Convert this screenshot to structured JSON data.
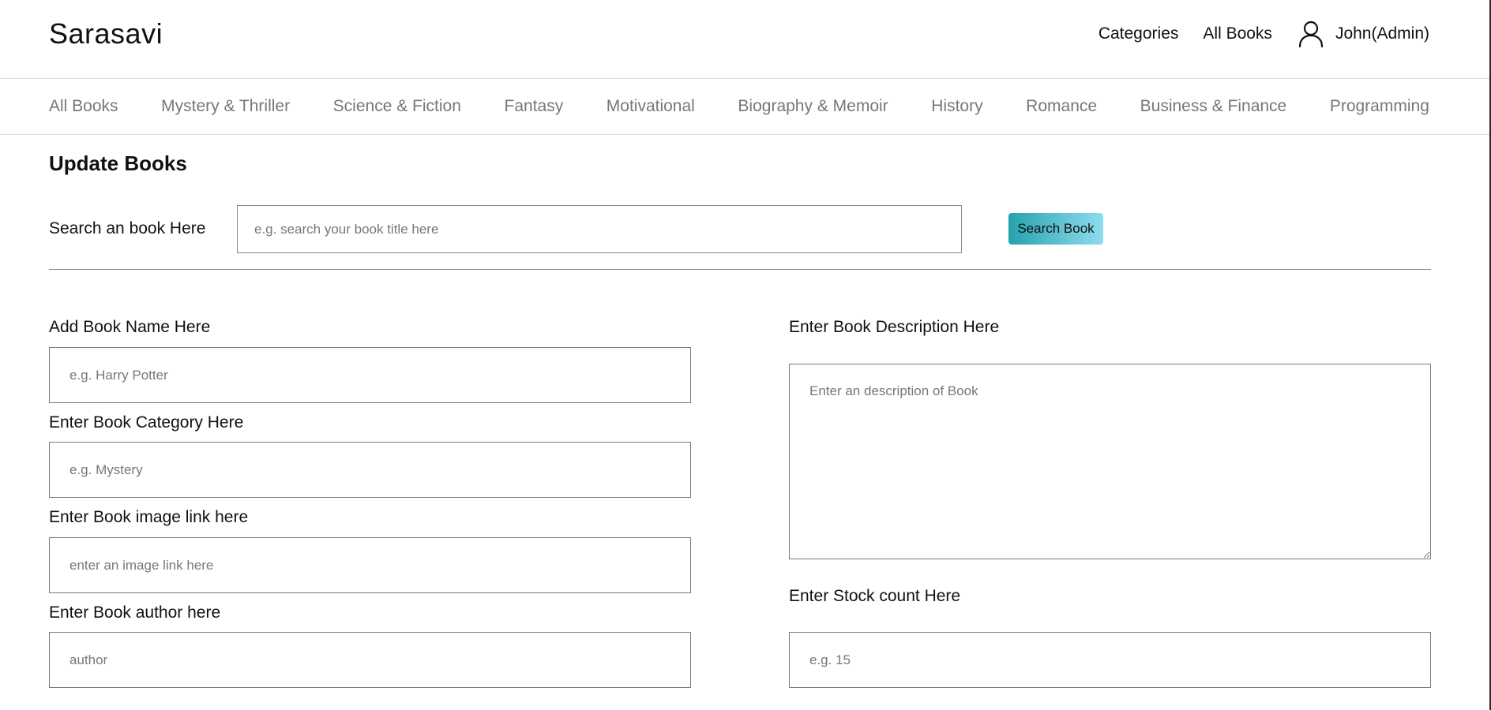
{
  "brand": "Sarasavi",
  "topnav": {
    "categories": "Categories",
    "all_books": "All Books",
    "user": "John(Admin)"
  },
  "categories": [
    "All Books",
    "Mystery & Thriller",
    "Science & Fiction",
    "Fantasy",
    "Motivational",
    "Biography & Memoir",
    "History",
    "Romance",
    "Business & Finance",
    "Programming"
  ],
  "page_title": "Update Books",
  "search": {
    "label": "Search an book Here",
    "placeholder": "e.g. search your book title here",
    "value": "",
    "button": "Search Book"
  },
  "form": {
    "name": {
      "label": "Add Book Name Here",
      "placeholder": "e.g. Harry Potter",
      "value": ""
    },
    "category": {
      "label": "Enter Book Category Here",
      "placeholder": "e.g. Mystery",
      "value": ""
    },
    "image": {
      "label": "Enter Book image link here",
      "placeholder": "enter an image link here",
      "value": ""
    },
    "author": {
      "label": "Enter Book author here",
      "placeholder": "author",
      "value": ""
    },
    "description": {
      "label": "Enter Book Description Here",
      "placeholder": "Enter an description of Book",
      "value": ""
    },
    "stock": {
      "label": "Enter Stock count Here",
      "placeholder": "e.g. 15",
      "value": ""
    }
  },
  "colors": {
    "button_gradient_start": "#27a2ac",
    "button_gradient_end": "#8fdcef",
    "category_text": "#777777"
  }
}
